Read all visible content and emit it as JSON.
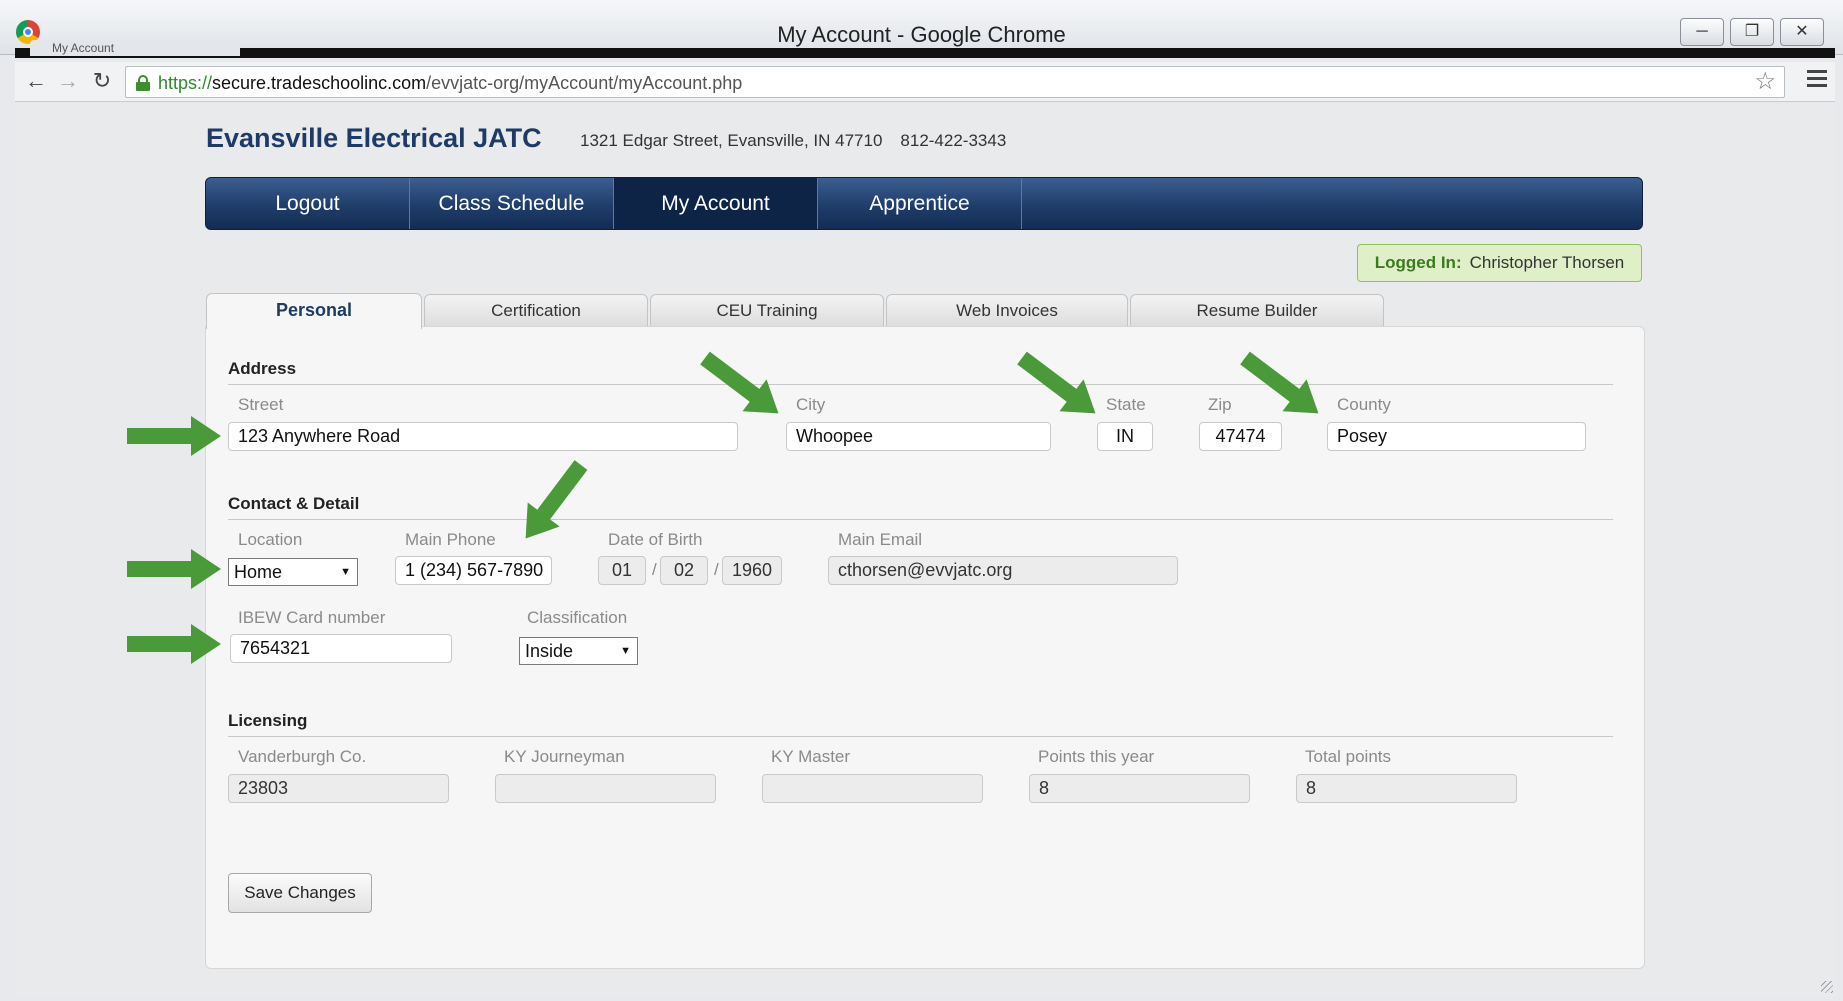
{
  "window": {
    "title": "My Account - Google Chrome",
    "tab_label": "My Account",
    "url_scheme": "https://",
    "url_host": "secure.tradeschoolinc.com",
    "url_path": "/evvjatc-org/myAccount/myAccount.php"
  },
  "org": {
    "name": "Evansville Electrical JATC",
    "address": "1321 Edgar Street, Evansville, IN 47710",
    "phone": "812-422-3343"
  },
  "nav": {
    "items": [
      {
        "label": "Logout"
      },
      {
        "label": "Class Schedule"
      },
      {
        "label": "My Account"
      },
      {
        "label": "Apprentice"
      }
    ],
    "active": "My Account"
  },
  "logged_in": {
    "label": "Logged In:",
    "name": "Christopher Thorsen"
  },
  "tabs": [
    {
      "label": "Personal"
    },
    {
      "label": "Certification"
    },
    {
      "label": "CEU Training"
    },
    {
      "label": "Web Invoices"
    },
    {
      "label": "Resume Builder"
    }
  ],
  "address": {
    "title": "Address",
    "street_label": "Street",
    "street": "123 Anywhere Road",
    "city_label": "City",
    "city": "Whoopee",
    "state_label": "State",
    "state": "IN",
    "zip_label": "Zip",
    "zip": "47474",
    "county_label": "County",
    "county": "Posey"
  },
  "contact": {
    "title": "Contact & Detail",
    "location_label": "Location",
    "location": "Home",
    "phone_label": "Main Phone",
    "phone": "1 (234) 567-7890",
    "dob_label": "Date of Birth",
    "dob_month": "01",
    "dob_day": "02",
    "dob_year": "1960",
    "dob_sep": "/",
    "email_label": "Main Email",
    "email": "cthorsen@evvjatc.org",
    "ibew_label": "IBEW Card number",
    "ibew": "7654321",
    "classification_label": "Classification",
    "classification": "Inside"
  },
  "licensing": {
    "title": "Licensing",
    "vanderburgh_label": "Vanderburgh Co.",
    "vanderburgh": "23803",
    "ky_journeyman_label": "KY Journeyman",
    "ky_journeyman": "",
    "ky_master_label": "KY Master",
    "ky_master": "",
    "points_year_label": "Points this year",
    "points_year": "8",
    "total_points_label": "Total points",
    "total_points": "8"
  },
  "actions": {
    "save_label": "Save Changes"
  },
  "colors": {
    "nav_bg": "#1f3d6a",
    "arrow": "#4a9a3a",
    "logged_in_bg": "#dff0c8"
  }
}
